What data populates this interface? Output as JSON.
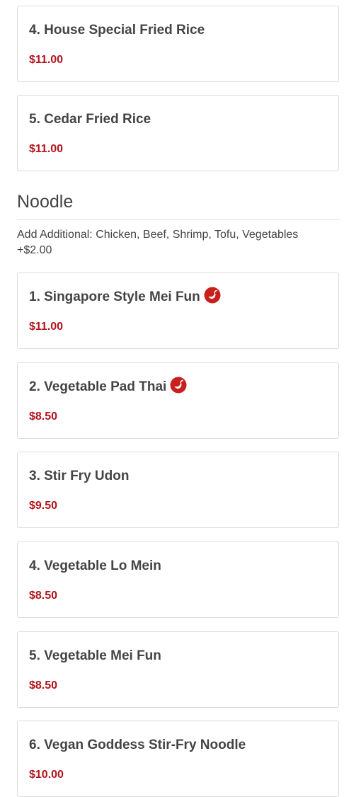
{
  "fried_rice": {
    "items": [
      {
        "name": "4. House Special Fried Rice",
        "price": "$11.00"
      },
      {
        "name": "5. Cedar Fried Rice",
        "price": "$11.00"
      }
    ]
  },
  "noodle": {
    "title": "Noodle",
    "description": "Add Additional: Chicken, Beef, Shrimp, Tofu, Vegetables +$2.00",
    "items": [
      {
        "name": "1. Singapore Style Mei Fun",
        "price": "$11.00",
        "icon": "spicy-pepper-icon"
      },
      {
        "name": "2. Vegetable Pad Thai",
        "price": "$8.50",
        "icon": "spicy-pepper-icon"
      },
      {
        "name": "3. Stir Fry Udon",
        "price": "$9.50"
      },
      {
        "name": "4. Vegetable Lo Mein",
        "price": "$8.50"
      },
      {
        "name": "5. Vegetable Mei Fun",
        "price": "$8.50"
      },
      {
        "name": "6. Vegan Goddess Stir-Fry Noodle",
        "price": "$10.00"
      }
    ]
  },
  "colors": {
    "price": "#b3141c",
    "spicy_icon": "#c8201e",
    "card_border": "#dcdcdc"
  }
}
